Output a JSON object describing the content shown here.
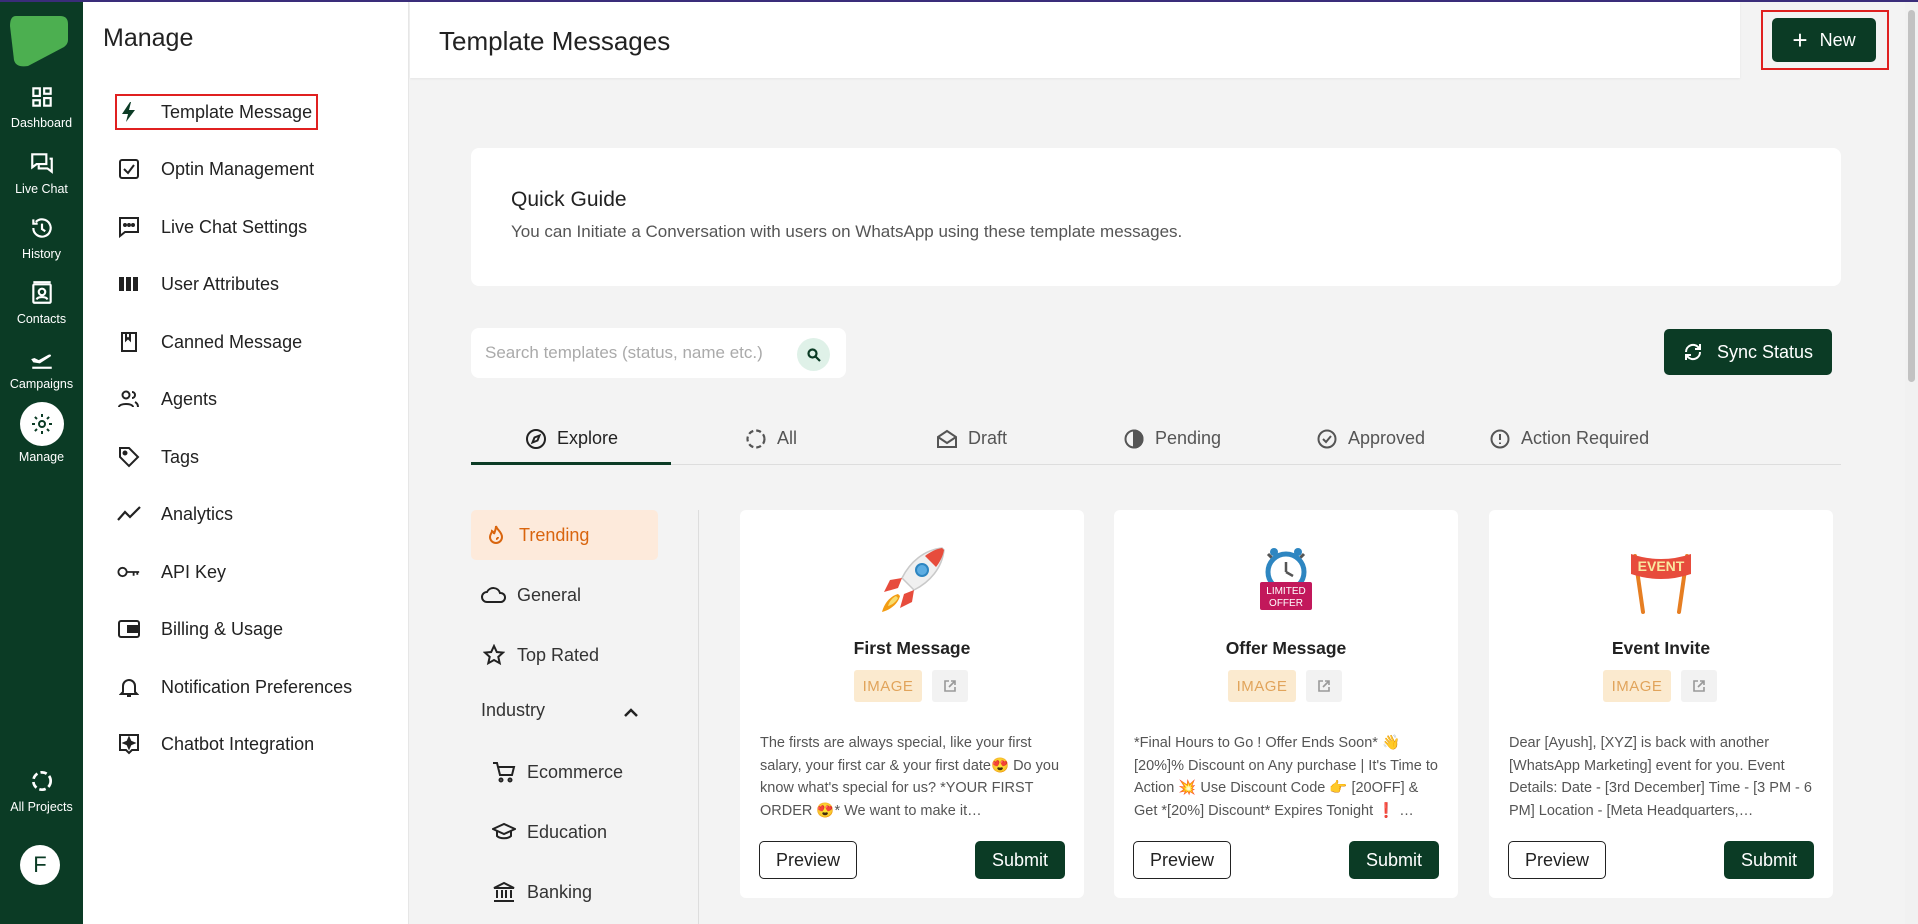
{
  "rail": {
    "items": [
      {
        "label": "Dashboard",
        "icon": "dashboard-icon"
      },
      {
        "label": "Live Chat",
        "icon": "chat-icon"
      },
      {
        "label": "History",
        "icon": "history-icon"
      },
      {
        "label": "Contacts",
        "icon": "contacts-icon"
      },
      {
        "label": "Campaigns",
        "icon": "plane-icon"
      },
      {
        "label": "Manage",
        "icon": "gear-icon"
      }
    ],
    "all_projects": "All Projects",
    "avatar_letter": "F"
  },
  "menu": {
    "title": "Manage",
    "items": [
      {
        "label": "Template Message",
        "icon": "bolt-icon"
      },
      {
        "label": "Optin Management",
        "icon": "checkbox-icon"
      },
      {
        "label": "Live Chat Settings",
        "icon": "chat-dots-icon"
      },
      {
        "label": "User Attributes",
        "icon": "columns-icon"
      },
      {
        "label": "Canned Message",
        "icon": "bookmark-icon"
      },
      {
        "label": "Agents",
        "icon": "people-icon"
      },
      {
        "label": "Tags",
        "icon": "tag-icon"
      },
      {
        "label": "Analytics",
        "icon": "trend-icon"
      },
      {
        "label": "API Key",
        "icon": "key-icon"
      },
      {
        "label": "Billing & Usage",
        "icon": "wallet-icon"
      },
      {
        "label": "Notification Preferences",
        "icon": "bell-icon"
      },
      {
        "label": "Chatbot Integration",
        "icon": "bot-icon"
      }
    ]
  },
  "header": {
    "title": "Template Messages",
    "new_label": "New"
  },
  "guide": {
    "title": "Quick Guide",
    "description": "You can Initiate a Conversation with users on WhatsApp using these template messages."
  },
  "search": {
    "placeholder": "Search templates (status, name etc.)"
  },
  "sync_label": "Sync Status",
  "tabs": [
    {
      "label": "Explore",
      "icon": "compass-icon"
    },
    {
      "label": "All",
      "icon": "spinner-icon"
    },
    {
      "label": "Draft",
      "icon": "envelope-open-icon"
    },
    {
      "label": "Pending",
      "icon": "half-circle-icon"
    },
    {
      "label": "Approved",
      "icon": "check-circle-icon"
    },
    {
      "label": "Action Required",
      "icon": "alert-circle-icon"
    }
  ],
  "categories": {
    "trending": "Trending",
    "general": "General",
    "top_rated": "Top Rated",
    "industry": "Industry",
    "ecommerce": "Ecommerce",
    "education": "Education",
    "banking": "Banking"
  },
  "cards": [
    {
      "title": "First Message",
      "badge": "IMAGE",
      "text": "The firsts are always special, like your first salary, your first car & your first date😍 Do you know what's special for us? *YOUR FIRST ORDER 😍* We want to make it…",
      "preview": "Preview",
      "submit": "Submit",
      "image": "rocket-icon"
    },
    {
      "title": "Offer Message",
      "badge": "IMAGE",
      "text": "*Final Hours to Go ! Offer Ends Soon* 👋 [20%]% Discount on Any purchase | It's Time to Action 💥 Use Discount Code 👉 [20OFF] & Get *[20%] Discount* Expires Tonight ❗ …",
      "preview": "Preview",
      "submit": "Submit",
      "image": "limited-offer-icon",
      "image_text": [
        "LIMITED",
        "OFFER"
      ]
    },
    {
      "title": "Event Invite",
      "badge": "IMAGE",
      "text": "Dear [Ayush], [XYZ] is back with another [WhatsApp Marketing] event for you. Event Details: Date - [3rd December] Time - [3 PM - 6 PM] Location - [Meta Headquarters,…",
      "preview": "Preview",
      "submit": "Submit",
      "image": "event-banner-icon",
      "image_text": "EVENT"
    }
  ],
  "colors": {
    "brand_dark": "#0b3b25",
    "highlight_red": "#e02020",
    "trending_bg": "#fdeadb",
    "trending_text": "#d9650e",
    "badge_bg": "#fbeacf"
  }
}
